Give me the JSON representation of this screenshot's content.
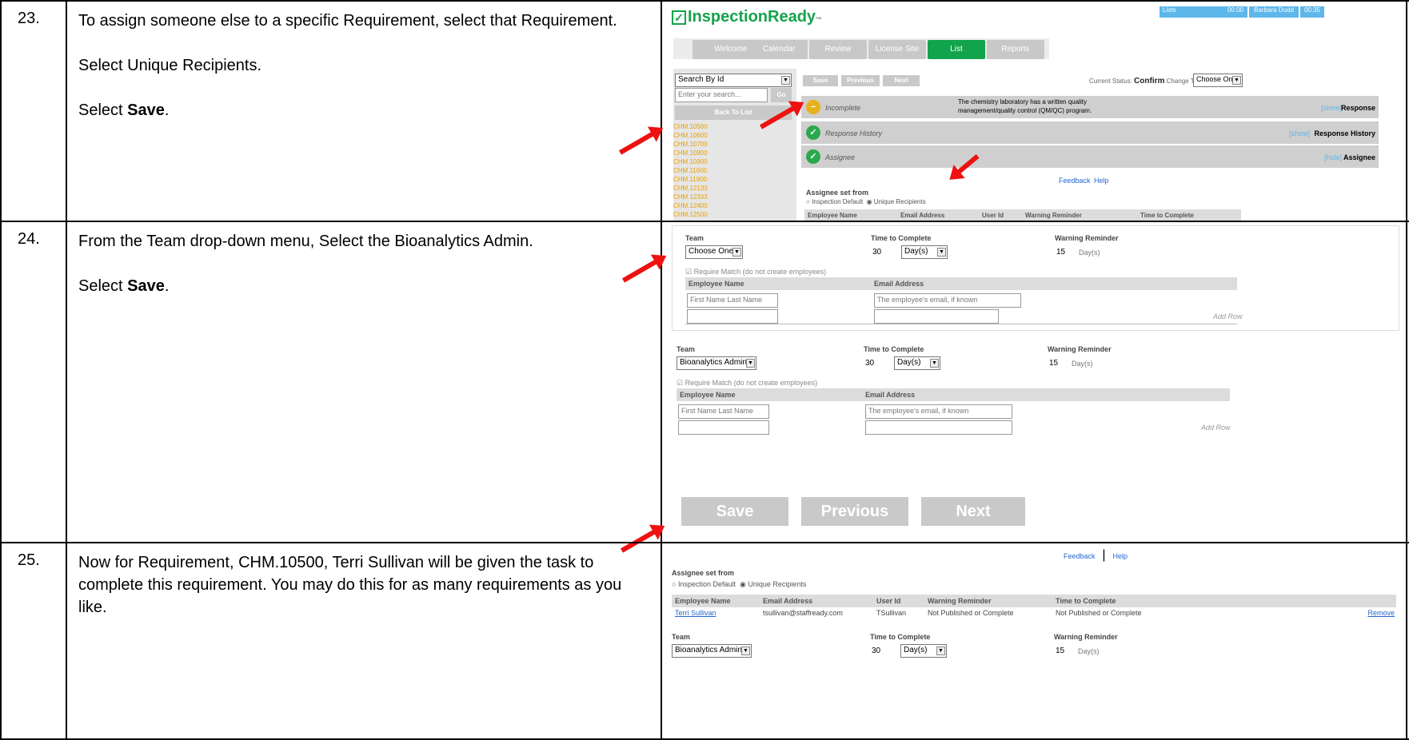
{
  "steps": [
    {
      "num": "23.",
      "lines": [
        "To assign someone else to a specific Requirement, select that Requirement.",
        "Select Unique Recipients."
      ],
      "save_prefix": "Select ",
      "save_bold": "Save",
      "save_suffix": "."
    },
    {
      "num": "24.",
      "lines": [
        "From the Team drop-down menu, Select the Bioanalytics Admin."
      ],
      "save_prefix": "Select ",
      "save_bold": "Save",
      "save_suffix": "."
    },
    {
      "num": "25.",
      "lines": [
        "Now for Requirement, CHM.10500, Terri Sullivan will be given the task to complete this requirement.  You may do this for as many requirements as you like."
      ]
    }
  ],
  "app": {
    "logo": "InspectionReady",
    "logo_tm": "™",
    "top": {
      "lists": "Lists",
      "time1": "00:00",
      "user": "Barbara Dodd",
      "time2": "00:35"
    },
    "tabs": [
      "Welcome",
      "Calendar",
      "Review",
      "License Site",
      "List",
      "Reports"
    ],
    "search_select": "Search By Id",
    "search_placeholder": "Enter your search...",
    "go": "Go",
    "back": "Back To List",
    "tree": [
      "CHM.10500",
      "CHM.10600",
      "CHM.10700",
      "CHM.10800",
      "CHM.10900",
      "CHM.11600",
      "CHM.11900",
      "CHM.12133",
      "CHM.12333",
      "CHM.12400",
      "CHM.12500"
    ],
    "toolbar": {
      "save": "Save",
      "previous": "Previous",
      "next": "Next",
      "status_label": "Current Status:",
      "status_value": "Confirm",
      "change_to": "Change To:",
      "change_value": "Choose One"
    },
    "panels": [
      {
        "label": "Incomplete",
        "text1": "The chemistry laboratory has a written quality",
        "text2": "management/quality control (QM/QC) program.",
        "show": "[show]",
        "right": "Response"
      },
      {
        "label": "Response History",
        "show": "[show]",
        "right": "Response History"
      },
      {
        "label": "Assignee",
        "show": "[hide]",
        "right": "Assignee"
      }
    ],
    "feedback": "Feedback",
    "help": "Help",
    "assignee_set_from": "Assignee set from",
    "radio1": "Inspection Default",
    "radio2": "Unique Recipients",
    "cols": [
      "Employee Name",
      "Email Address",
      "User Id",
      "Warning Reminder",
      "Time to Complete"
    ],
    "team_label": "Team",
    "ttc_label": "Time to Complete",
    "warn_label": "Warning Reminder",
    "team_choose": "Choose One",
    "team_bio": "Bioanalytics Admin",
    "ttc_value": "30",
    "days": "Day(s)",
    "warn_value": "15",
    "warn_unit": "Day(s)",
    "require_match": "Require Match (do not create employees)",
    "emp_col": "Employee Name",
    "email_col": "Email Address",
    "emp_placeholder": "First Name  Last Name",
    "email_placeholder": "The employee's email, if known",
    "add_row": "Add Row",
    "big": {
      "save": "Save",
      "previous": "Previous",
      "next": "Next"
    },
    "row": {
      "name": "Terri Sullivan",
      "email": "tsullivan@staffready.com",
      "userid": "TSullivan",
      "warning": "Not Published or Complete",
      "ttc": "Not Published or Complete",
      "remove": "Remove"
    }
  }
}
